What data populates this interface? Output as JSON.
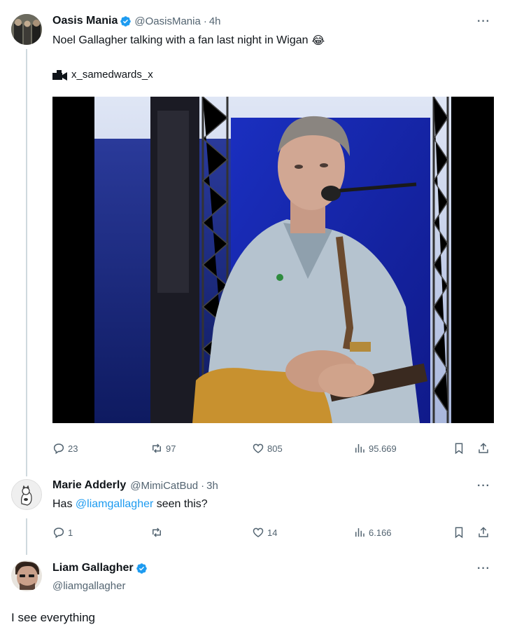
{
  "tweet1": {
    "name": "Oasis Mania",
    "handle": "@OasisMania",
    "separator": "·",
    "time": "4h",
    "text": "Noel Gallagher talking with a fan last night in Wigan",
    "emoji": "😂",
    "credit": "x_samedwards_x",
    "stats": {
      "replies": "23",
      "reposts": "97",
      "likes": "805",
      "views": "95.669"
    }
  },
  "tweet2": {
    "name": "Marie Adderly",
    "handle": "@MimiCatBud",
    "separator": "·",
    "time": "3h",
    "text_prefix": "Has ",
    "mention": "@liamgallagher",
    "text_suffix": " seen this?",
    "stats": {
      "replies": "1",
      "reposts": "",
      "likes": "14",
      "views": "6.166"
    }
  },
  "tweet3": {
    "name": "Liam Gallagher",
    "handle": "@liamgallagher",
    "text": "I see everything"
  },
  "icons": {
    "more": "···",
    "reply": "reply-icon",
    "repost": "repost-icon",
    "like": "heart-icon",
    "views": "views-icon",
    "bookmark": "bookmark-icon",
    "share": "share-icon"
  },
  "colors": {
    "accent": "#1d9bf0",
    "muted": "#536471",
    "text": "#0f1419"
  }
}
